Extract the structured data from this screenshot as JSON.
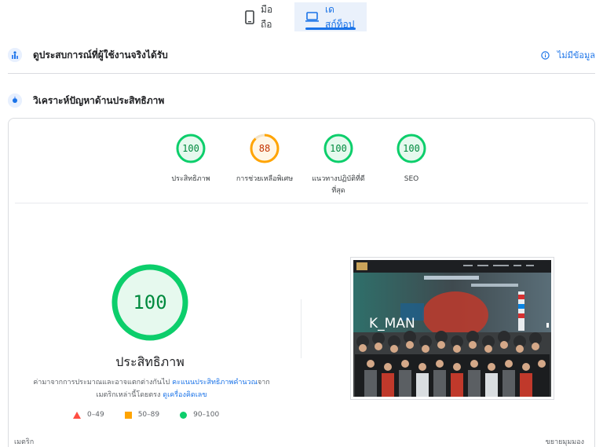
{
  "tabs": {
    "mobile": "มือถือ",
    "desktop": "เดสก์ท็อป"
  },
  "field_data": {
    "title": "ดูประสบการณ์ที่ผู้ใช้งานจริงได้รับ",
    "status": "ไม่มีข้อมูล"
  },
  "diagnose": {
    "title": "วิเคราะห์ปัญหาด้านประสิทธิภาพ"
  },
  "scores": [
    {
      "value": "100",
      "label": "ประสิทธิภาพ",
      "color": "#0cce6b"
    },
    {
      "value": "88",
      "label": "การช่วยเหลือพิเศษ",
      "color": "#ffa400"
    },
    {
      "value": "100",
      "label_line1": "แนวทางปฏิบัติที่ดี",
      "label_line2": "ที่สุด",
      "color": "#0cce6b"
    },
    {
      "value": "100",
      "label": "SEO",
      "color": "#0cce6b"
    }
  ],
  "performance": {
    "score": "100",
    "title": "ประสิทธิภาพ",
    "note_part1": "ค่ามาจากการประมาณและอาจแตกต่างกันไป ",
    "note_link1": "คะแนนประสิทธิภาพคำนวณ",
    "note_part2": "จาก",
    "note_part3": "เมตริกเหล่านี้โดยตรง ",
    "note_link2": "ดูเครื่องคิดเลข"
  },
  "legend": {
    "fail": "0–49",
    "average": "50–89",
    "pass": "90–100"
  },
  "screenshot": {
    "brand_text": "K_MAN"
  },
  "footer": {
    "metrics": "เมตริก",
    "expand": "ขยายมุมมอง"
  },
  "colors": {
    "pass": "#0cce6b",
    "average": "#ffa400",
    "fail": "#ff4e42",
    "accent": "#1a73e8"
  }
}
